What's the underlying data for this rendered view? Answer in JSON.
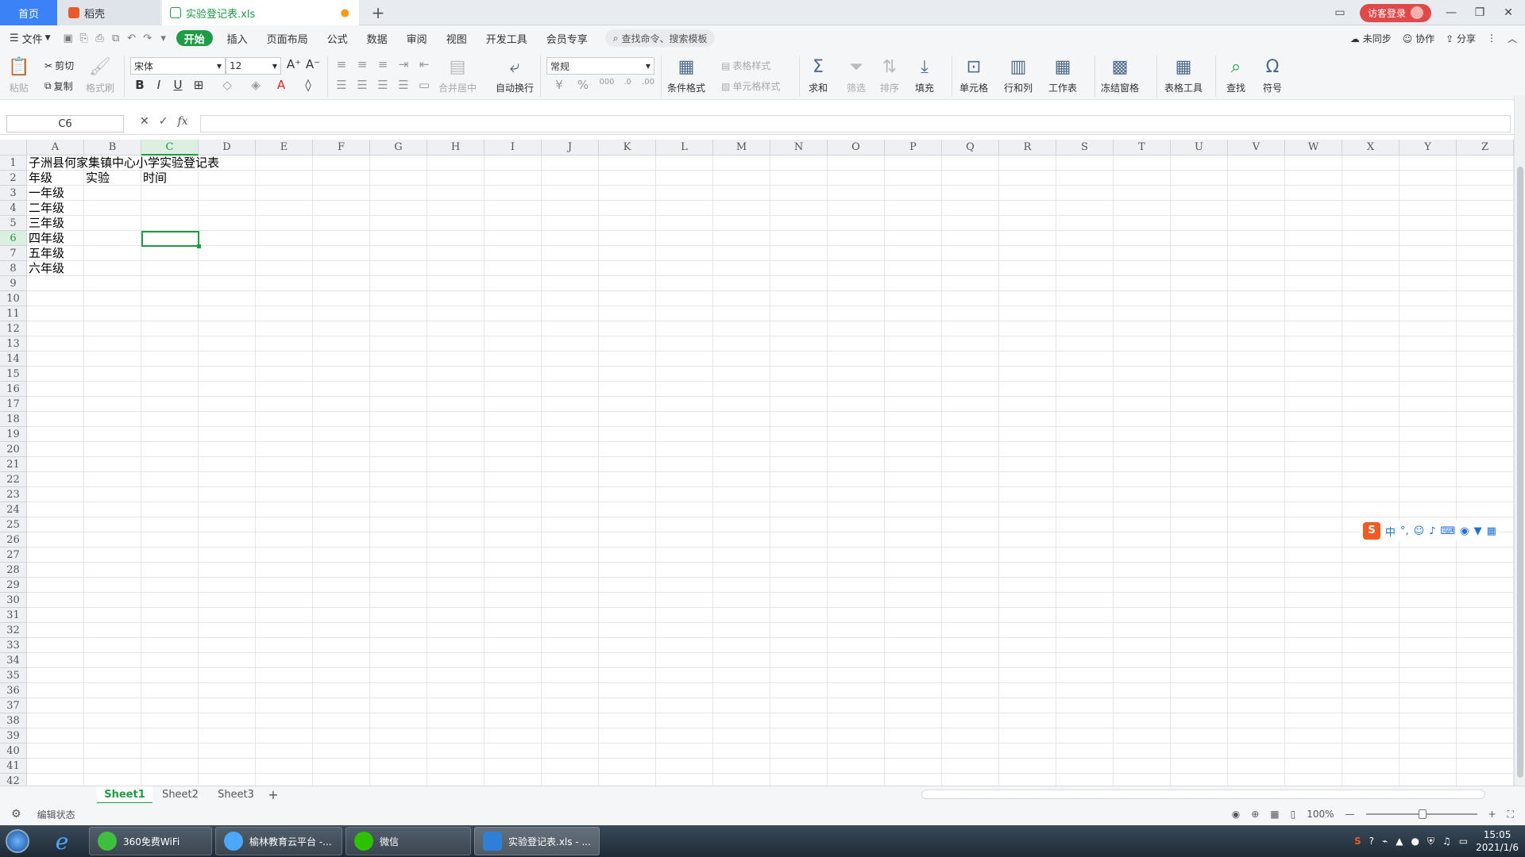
{
  "tabs": {
    "home": "首页",
    "daoke": "稻壳",
    "file": "实验登记表.xls",
    "add": "+"
  },
  "account": {
    "login": "访客登录"
  },
  "menu": {
    "file": "文件",
    "start": "开始",
    "items": [
      "插入",
      "页面布局",
      "公式",
      "数据",
      "审阅",
      "视图",
      "开发工具",
      "会员专享"
    ],
    "search": "查找命令、搜索模板",
    "unsynced": "未同步",
    "collab": "协作",
    "share": "分享"
  },
  "ribbon": {
    "paste": "粘贴",
    "cut": "剪切",
    "copy": "复制",
    "format_painter": "格式刷",
    "font_name": "宋体",
    "font_size": "12",
    "merge_center": "合并居中",
    "wrap_text": "自动换行",
    "number_format": "常规",
    "conditional_format": "条件格式",
    "table_style": "表格样式",
    "cell_style": "单元格样式",
    "sum": "求和",
    "filter": "筛选",
    "sort": "排序",
    "fill": "填充",
    "cell": "单元格",
    "row_col": "行和列",
    "worksheet": "工作表",
    "freeze": "冻结窗格",
    "table_tools": "表格工具",
    "find": "查找",
    "symbol": "符号"
  },
  "formula_bar": {
    "name_box": "C6",
    "fx": "fx"
  },
  "columns": [
    "A",
    "B",
    "C",
    "D",
    "E",
    "F",
    "G",
    "H",
    "I",
    "J",
    "K",
    "L",
    "M",
    "N",
    "O",
    "P",
    "Q",
    "R",
    "S",
    "T",
    "U",
    "V",
    "W",
    "X",
    "Y",
    "Z"
  ],
  "selected_column": "C",
  "selected_row": 6,
  "cells": {
    "A1": "子洲县何家集镇中心小学实验登记表",
    "A2": "年级",
    "B2": "实验",
    "C2": "时间",
    "A3": "一年级",
    "A4": "二年级",
    "A5": "三年级",
    "A6": "四年级",
    "A7": "五年级",
    "A8": "六年级"
  },
  "sheets": [
    "Sheet1",
    "Sheet2",
    "Sheet3"
  ],
  "active_sheet": "Sheet1",
  "status": {
    "mode": "编辑状态",
    "zoom": "100%"
  },
  "taskbar": {
    "items": [
      "360免费WiFi",
      "榆林教育云平台 -...",
      "微信",
      "实验登记表.xls - ..."
    ],
    "time": "15:05",
    "date": "2021/1/6"
  },
  "ime": {
    "label": "中"
  }
}
